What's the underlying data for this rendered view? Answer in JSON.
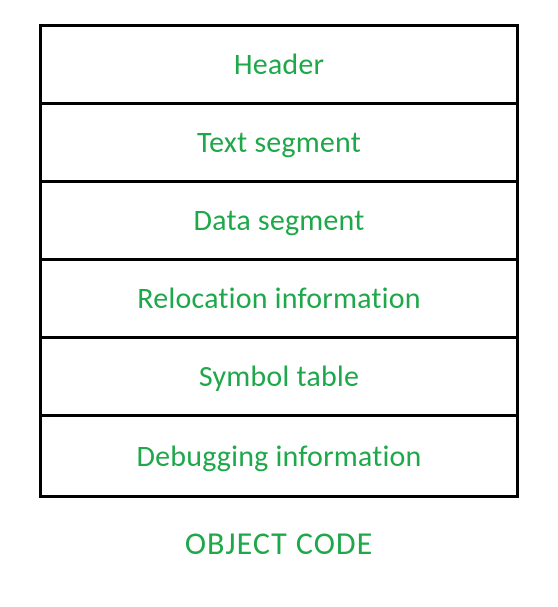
{
  "rows": [
    {
      "label": "Header"
    },
    {
      "label": "Text segment"
    },
    {
      "label": "Data segment"
    },
    {
      "label": "Relocation information"
    },
    {
      "label": "Symbol table"
    },
    {
      "label": "Debugging information"
    }
  ],
  "caption": "OBJECT CODE",
  "colors": {
    "text": "#1ea84a",
    "border": "#000000",
    "background": "#ffffff"
  }
}
